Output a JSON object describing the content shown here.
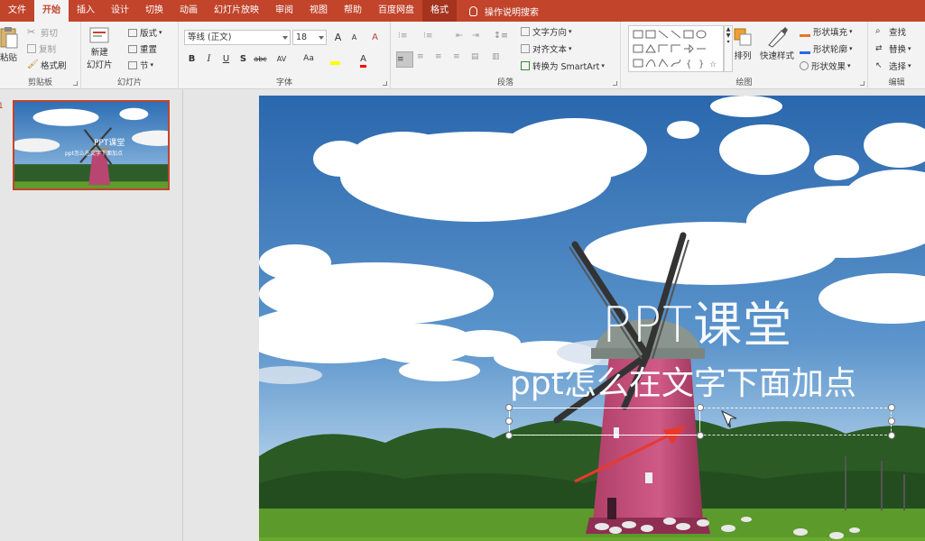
{
  "tabs": [
    "文件",
    "开始",
    "插入",
    "设计",
    "切换",
    "动画",
    "幻灯片放映",
    "审阅",
    "视图",
    "帮助",
    "百度网盘",
    "格式"
  ],
  "active_tab": "开始",
  "tell_me": "操作说明搜索",
  "clipboard": {
    "paste": "粘贴",
    "cut": "剪切",
    "copy": "复制",
    "format_painter": "格式刷",
    "label": "剪贴板"
  },
  "slides": {
    "new_slide_line1": "新建",
    "new_slide_line2": "幻灯片",
    "layout": "版式",
    "reset": "重置",
    "section": "节",
    "label": "幻灯片"
  },
  "font": {
    "name": "等线 (正文)",
    "size": "18",
    "label": "字体",
    "bold": "B",
    "italic": "I",
    "underline": "U",
    "shadow": "S",
    "strike": "abc",
    "spacing": "AV",
    "case": "Aa",
    "grow": "A",
    "shrink": "A",
    "clear": "A"
  },
  "paragraph": {
    "text_direction": "文字方向",
    "align_text": "对齐文本",
    "smartart": "转换为 SmartArt",
    "label": "段落"
  },
  "drawing": {
    "arrange": "排列",
    "quick_styles": "快速样式",
    "shape_fill": "形状填充",
    "shape_outline": "形状轮廓",
    "shape_effects": "形状效果",
    "label": "绘图"
  },
  "editing": {
    "find": "查找",
    "replace": "替换",
    "select": "选择",
    "label": "编辑"
  },
  "slide_number": "1",
  "thumbnail": {
    "title": "PPT课堂",
    "subtitle": "ppt怎么在文字下面加点"
  },
  "slide_content": {
    "title": "PPT课堂",
    "subtitle": "ppt怎么在文字下面加点"
  },
  "colors": {
    "accent": "#c1442b",
    "ribbon": "#f3f3f3",
    "highlight": "#ffff00",
    "font_color": "#ff0000",
    "arrow": "#e8392e"
  }
}
